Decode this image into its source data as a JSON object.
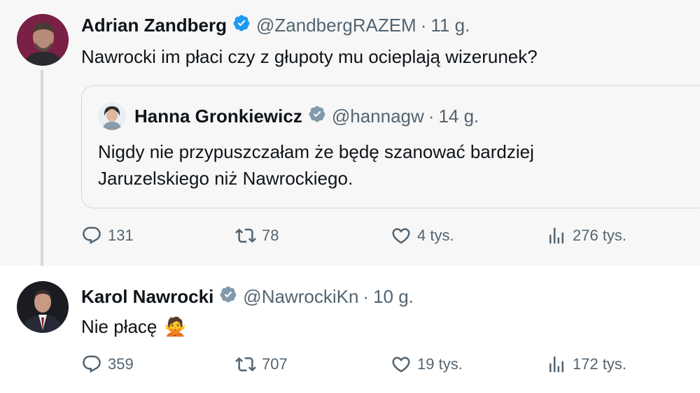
{
  "tweet1": {
    "name": "Adrian Zandberg",
    "handle": "@ZandbergRAZEM",
    "separator": "·",
    "time": "11 g.",
    "text": "Nawrocki im płaci czy z głupoty mu ocieplają wizerunek?",
    "quote": {
      "name": "Hanna Gronkiewicz",
      "handle": "@hannagw",
      "separator": "·",
      "time": "14 g.",
      "text_line1": "Nigdy nie przypuszczałam że będę szanować bardziej",
      "text_line2": "Jaruzelskiego niż  Nawrockiego."
    },
    "stats": {
      "replies": "131",
      "reposts": "78",
      "likes": "4 tys.",
      "views": "276 tys."
    }
  },
  "tweet2": {
    "name": "Karol Nawrocki",
    "handle": "@NawrockiKn",
    "separator": "·",
    "time": "10 g.",
    "text": "Nie płacę",
    "emoji": "🙅",
    "stats": {
      "replies": "359",
      "reposts": "707",
      "likes": "19 tys.",
      "views": "172 tys."
    }
  },
  "icons": {
    "verified": "verified-badge-icon",
    "verified_color_blue": "#1d9bf0",
    "verified_color_gray": "#829aab",
    "reply": "reply-icon",
    "repost": "repost-icon",
    "like": "heart-icon",
    "views": "views-chart-icon"
  }
}
